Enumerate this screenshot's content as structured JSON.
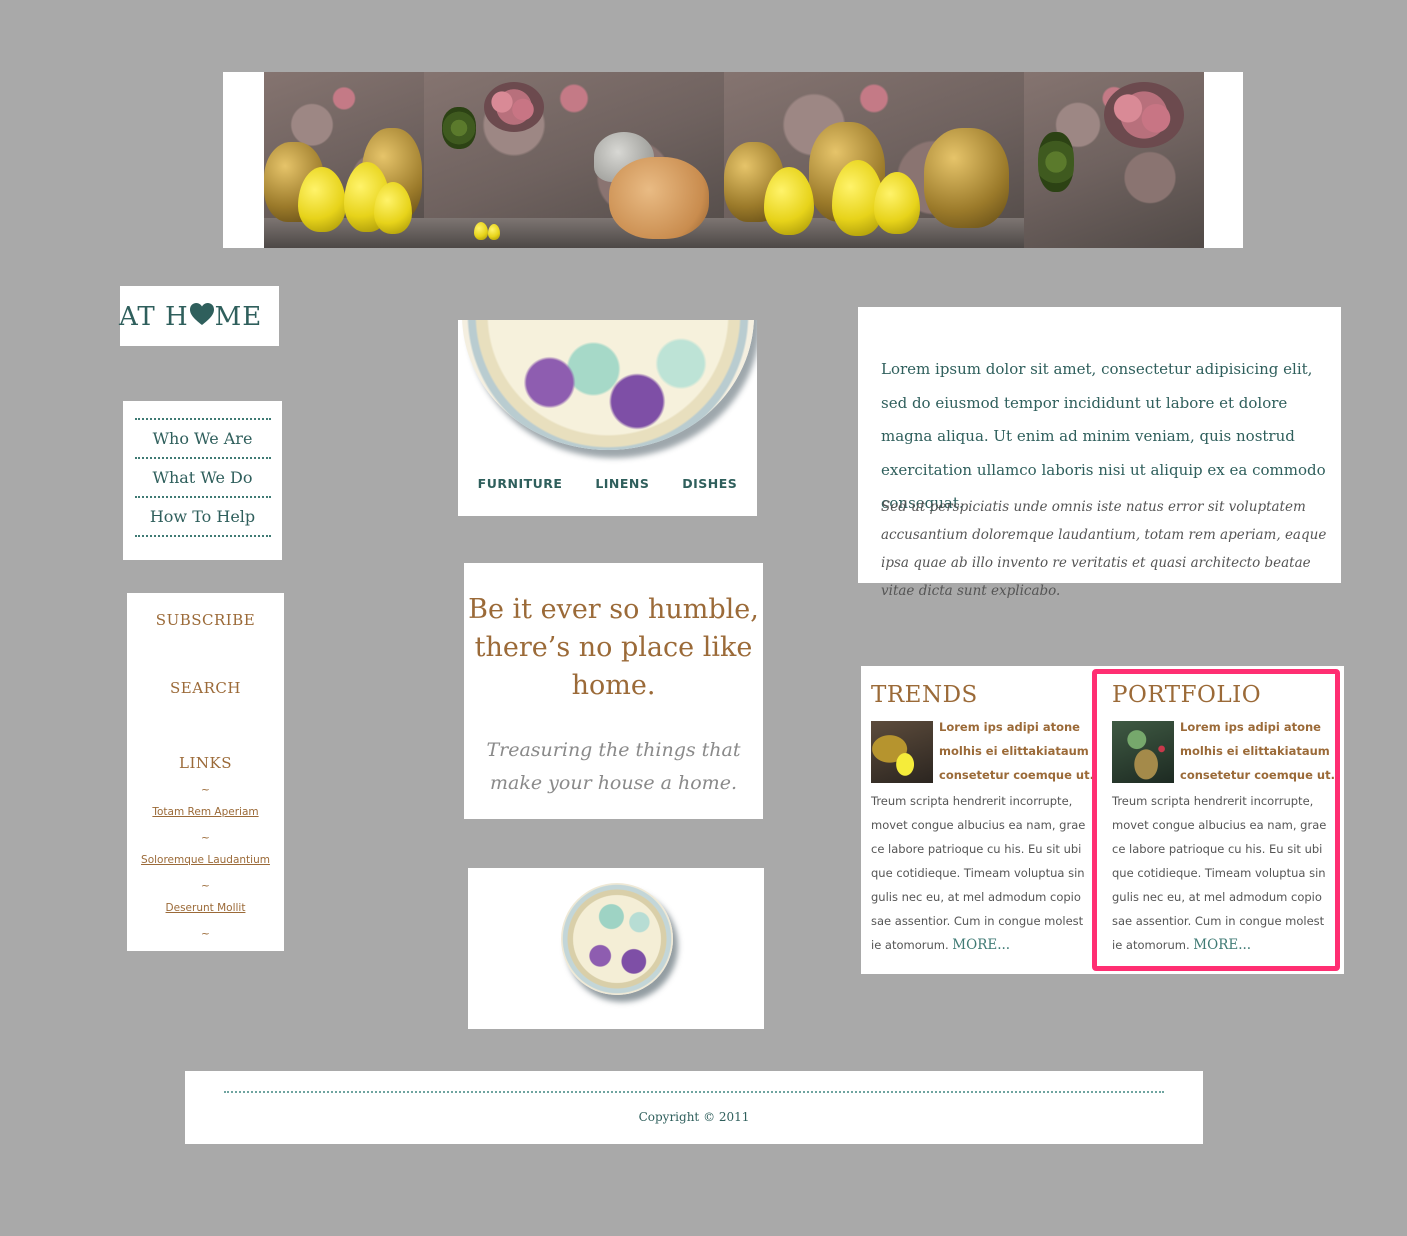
{
  "logo": {
    "text_before": "AT H",
    "text_after": "ME",
    "heart_icon": "heart-icon",
    "color": "#2f5f5c"
  },
  "nav": {
    "items": [
      {
        "label": "Who We Are"
      },
      {
        "label": "What We Do"
      },
      {
        "label": "How To Help"
      }
    ]
  },
  "sidebar": {
    "subscribe": "SUBSCRIBE",
    "search": "SEARCH",
    "links_title": "LINKS",
    "tilde": "~",
    "links": [
      {
        "label": "Totam Rem Aperiam"
      },
      {
        "label": "Soloremque Laudantium"
      },
      {
        "label": "Deserunt Mollit "
      }
    ]
  },
  "plate_menu": {
    "items": [
      {
        "label": "FURNITURE"
      },
      {
        "label": "LINENS"
      },
      {
        "label": "DISHES"
      }
    ]
  },
  "quote": {
    "headline": "Be it ever so humble, there’s no place like home.",
    "tagline": "Treasuring the things that make your house a home."
  },
  "intro": {
    "paragraph1": "Lorem ipsum dolor sit amet, consectetur adipisicing elit, sed do eiusmod tempor incididunt ut labore et dolore magna aliqua. Ut enim ad minim veniam, quis nostrud exercitation ullamco laboris nisi ut aliquip ex ea commodo consequat.",
    "paragraph2": "Sed ut perspiciatis unde omnis iste natus error sit voluptatem accusantium doloremque laudantium, totam rem aperiam, eaque ipsa quae ab illo invento re veritatis et quasi architecto beatae vitae dicta sunt explicabo."
  },
  "trends": {
    "title": "TRENDS",
    "lead": "Lorem ips adipi atone molhis ei elittakiataum consetetur coemque ut.",
    "body": "Treum scripta hendrerit incorrupte, movet congue albucius ea nam, grae ce labore patrioque cu his. Eu sit ubi que cotidieque. Timeam voluptua sin gulis nec eu, at mel admodum copio sae assentior. Cum in congue molest ie atomorum.",
    "more": "MORE..."
  },
  "portfolio": {
    "title": "PORTFOLIO",
    "lead": "Lorem ips adipi atone molhis ei elittakiataum consetetur coemque ut.",
    "body": "Treum scripta hendrerit incorrupte, movet congue albucius ea nam, grae ce labore patrioque cu his. Eu sit ubi que cotidieque. Timeam voluptua sin gulis nec eu, at mel admodum copio sae assentior. Cum in congue molest ie atomorum.",
    "more": "MORE..."
  },
  "footer": {
    "copyright": "Copyright © 2011"
  },
  "colors": {
    "background": "#a9a9a9",
    "teal": "#2f5f5c",
    "brown": "#9b6a38",
    "highlight": "#ff2e72"
  }
}
